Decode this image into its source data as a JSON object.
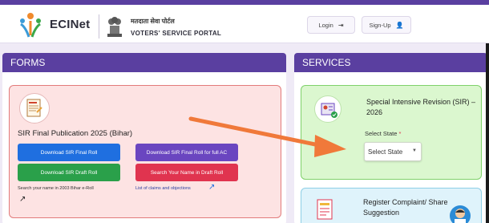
{
  "header": {
    "logo_text": "ECINet",
    "portal_hindi": "मतदाता सेवा पोर्टल",
    "portal_english": "VOTERS' SERVICE PORTAL",
    "login_label": "Login",
    "signup_label": "Sign-Up"
  },
  "forms": {
    "heading": "FORMS",
    "card_title": "SIR Final Publication 2025 (Bihar)",
    "buttons": [
      "Download SIR Final Roll",
      "Download SIR Final Roll for full AC",
      "Download SIR Draft Roll",
      "Search Your Name in Draft Roll"
    ],
    "link_search_2003": "Search your name in 2003 Bihar e-Roll",
    "link_claims": "List of claims and objections"
  },
  "services": {
    "heading": "SERVICES",
    "sir_title": "Special Intensive Revision (SIR) – 2026",
    "select_label": "Select State",
    "select_required_mark": "*",
    "select_value": "Select State",
    "complaint_title": "Register Complaint/ Share Suggestion"
  },
  "colors": {
    "brand_purple": "#5a3fa0",
    "annotation_arrow": "#f0793a",
    "btn_blue": "#1f6fe0",
    "btn_purple": "#6a46c0",
    "btn_green": "#2aa04a",
    "btn_red": "#e0344f"
  }
}
